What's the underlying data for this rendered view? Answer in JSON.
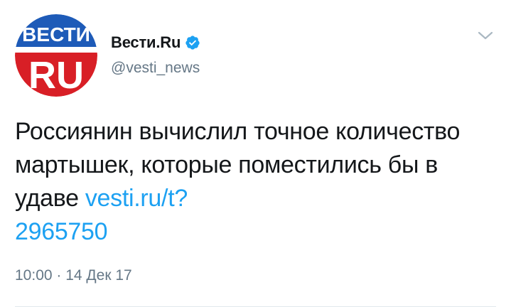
{
  "author": {
    "name": "Вести.Ru",
    "handle": "@vesti_news",
    "verified": true,
    "avatar": {
      "top_text": "ВЕСТИ",
      "bottom_text": "RU",
      "colors": {
        "top": "#1e5bb8",
        "bottom": "#d81f26",
        "text": "#ffffff"
      }
    }
  },
  "tweet": {
    "text": "Россиянин вычислил точное количество мартышек, которые поместились бы в удаве ",
    "link_text": "vesti.ru/t?2965750",
    "link_line1": "vesti.ru/t?",
    "link_line2": "2965750"
  },
  "meta": {
    "time": "10:00",
    "separator": " · ",
    "date": "14 Дек 17"
  },
  "icons": {
    "verified": "verified-badge-icon",
    "menu": "chevron-down-icon"
  },
  "colors": {
    "text": "#14171a",
    "secondary": "#657786",
    "link": "#1da1f2",
    "verified": "#1da1f2"
  }
}
